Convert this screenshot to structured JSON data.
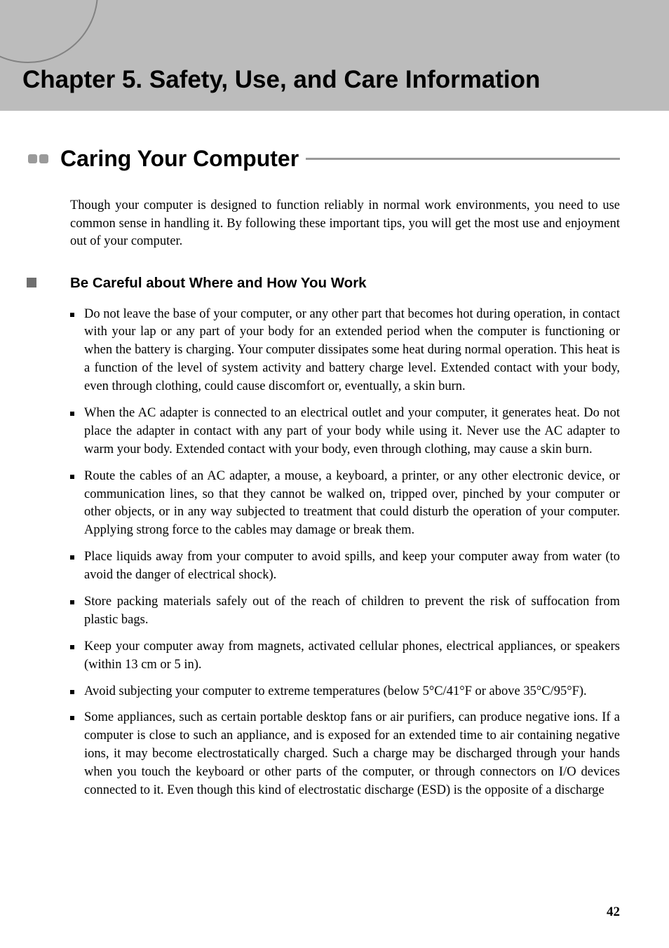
{
  "chapter": "Chapter 5. Safety, Use, and Care Information",
  "section": "Caring Your Computer",
  "intro": "Though your computer is designed to function reliably in normal work environments, you need to use common sense in handling it. By following these important tips, you will get the most use and enjoyment out of your computer.",
  "subheading": "Be Careful about Where and How You Work",
  "bullets": [
    "Do not leave the base of your computer, or any other part that becomes hot during operation, in contact with your lap or any part of your body for an extended period when the computer is functioning or when the battery is charging. Your computer dissipates some heat during normal operation. This heat is a function of the level of system activity and battery charge level. Extended contact with your body, even through clothing, could cause discomfort or, eventually, a skin burn.",
    "When the AC adapter is connected to an electrical outlet and your computer, it generates heat. Do not place the adapter in contact with any part of your body while using it. Never use the AC adapter to warm your body. Extended contact with your body, even through clothing, may cause a skin burn.",
    "Route the cables of an AC adapter, a mouse, a keyboard, a printer, or any other electronic device, or communication lines, so that they cannot be walked on, tripped over, pinched by your computer or other objects, or in any way subjected to treatment that could disturb the operation of your computer. Applying strong force to the cables may damage or break them.",
    "Place liquids away from your computer to avoid spills, and keep your computer away from water (to avoid the danger of electrical shock).",
    "Store packing materials safely out of the reach of children to prevent the risk of suffocation from plastic bags.",
    "Keep your computer away from magnets, activated cellular phones, electrical appliances, or speakers (within 13 cm or 5 in).",
    "Avoid subjecting your computer to extreme temperatures (below 5°C/41°F or above 35°C/95°F).",
    "Some appliances, such as certain portable desktop fans or air purifiers, can produce negative ions. If a computer is close to such an appliance, and is exposed for an extended time to air containing negative ions, it may become electrostatically charged. Such a charge may be discharged through your hands when you touch the keyboard or other parts of the computer, or through connectors on I/O devices connected to it. Even though this kind of electrostatic discharge (ESD) is the opposite of a discharge"
  ],
  "page_number": "42"
}
